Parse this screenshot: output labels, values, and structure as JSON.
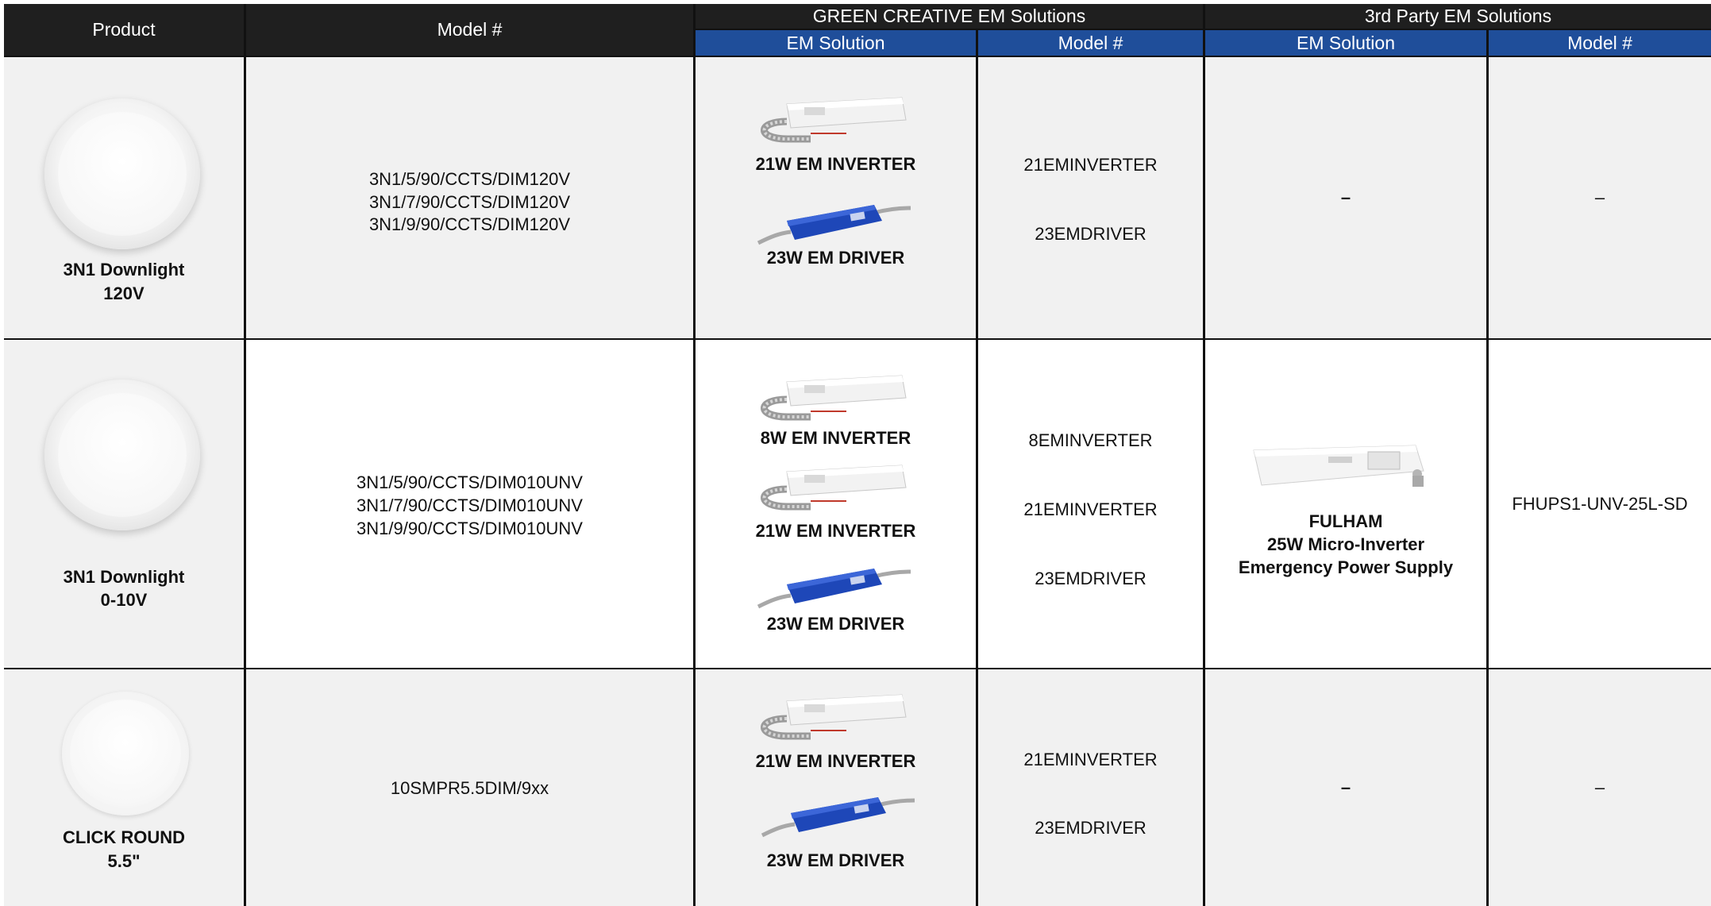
{
  "header": {
    "product": "Product",
    "model": "Model #",
    "green_group": "GREEN CREATIVE EM Solutions",
    "third_group": "3rd Party EM Solutions",
    "em_solution": "EM Solution",
    "model_sub": "Model #",
    "em_solution_3rd": "EM Solution",
    "model_sub_3rd": "Model #"
  },
  "rows": [
    {
      "product_line1": "3N1 Downlight",
      "product_line2": "120V",
      "models": [
        "3N1/5/90/CCTS/DIM120V",
        "3N1/7/90/CCTS/DIM120V",
        "3N1/9/90/CCTS/DIM120V"
      ],
      "green": [
        {
          "label": "21W EM INVERTER",
          "model": "21EMINVERTER",
          "icon": "em-inverter-icon"
        },
        {
          "label": "23W EM DRIVER",
          "model": "23EMDRIVER",
          "icon": "em-driver-icon"
        }
      ],
      "third_solution": "–",
      "third_model": "–"
    },
    {
      "product_line1": "3N1 Downlight",
      "product_line2": "0-10V",
      "models": [
        "3N1/5/90/CCTS/DIM010UNV",
        "3N1/7/90/CCTS/DIM010UNV",
        "3N1/9/90/CCTS/DIM010UNV"
      ],
      "green": [
        {
          "label": "8W EM INVERTER",
          "model": "8EMINVERTER",
          "icon": "em-inverter-icon"
        },
        {
          "label": "21W EM INVERTER",
          "model": "21EMINVERTER",
          "icon": "em-inverter-icon"
        },
        {
          "label": "23W EM DRIVER",
          "model": "23EMDRIVER",
          "icon": "em-driver-icon"
        }
      ],
      "third_solution_lines": [
        "FULHAM",
        "25W Micro-Inverter",
        "Emergency Power Supply"
      ],
      "third_model": "FHUPS1-UNV-25L-SD"
    },
    {
      "product_line1": "CLICK ROUND",
      "product_line2": "5.5\"",
      "models": [
        "10SMPR5.5DIM/9xx"
      ],
      "green": [
        {
          "label": "21W EM INVERTER",
          "model": "21EMINVERTER",
          "icon": "em-inverter-icon"
        },
        {
          "label": "23W EM DRIVER",
          "model": "23EMDRIVER",
          "icon": "em-driver-icon"
        }
      ],
      "third_solution": "–",
      "third_model": "–"
    }
  ],
  "colors": {
    "header_dark": "#1f1f1f",
    "header_blue": "#1f4e9a",
    "row_grey": "#f1f1f1",
    "grid": "#111111"
  }
}
